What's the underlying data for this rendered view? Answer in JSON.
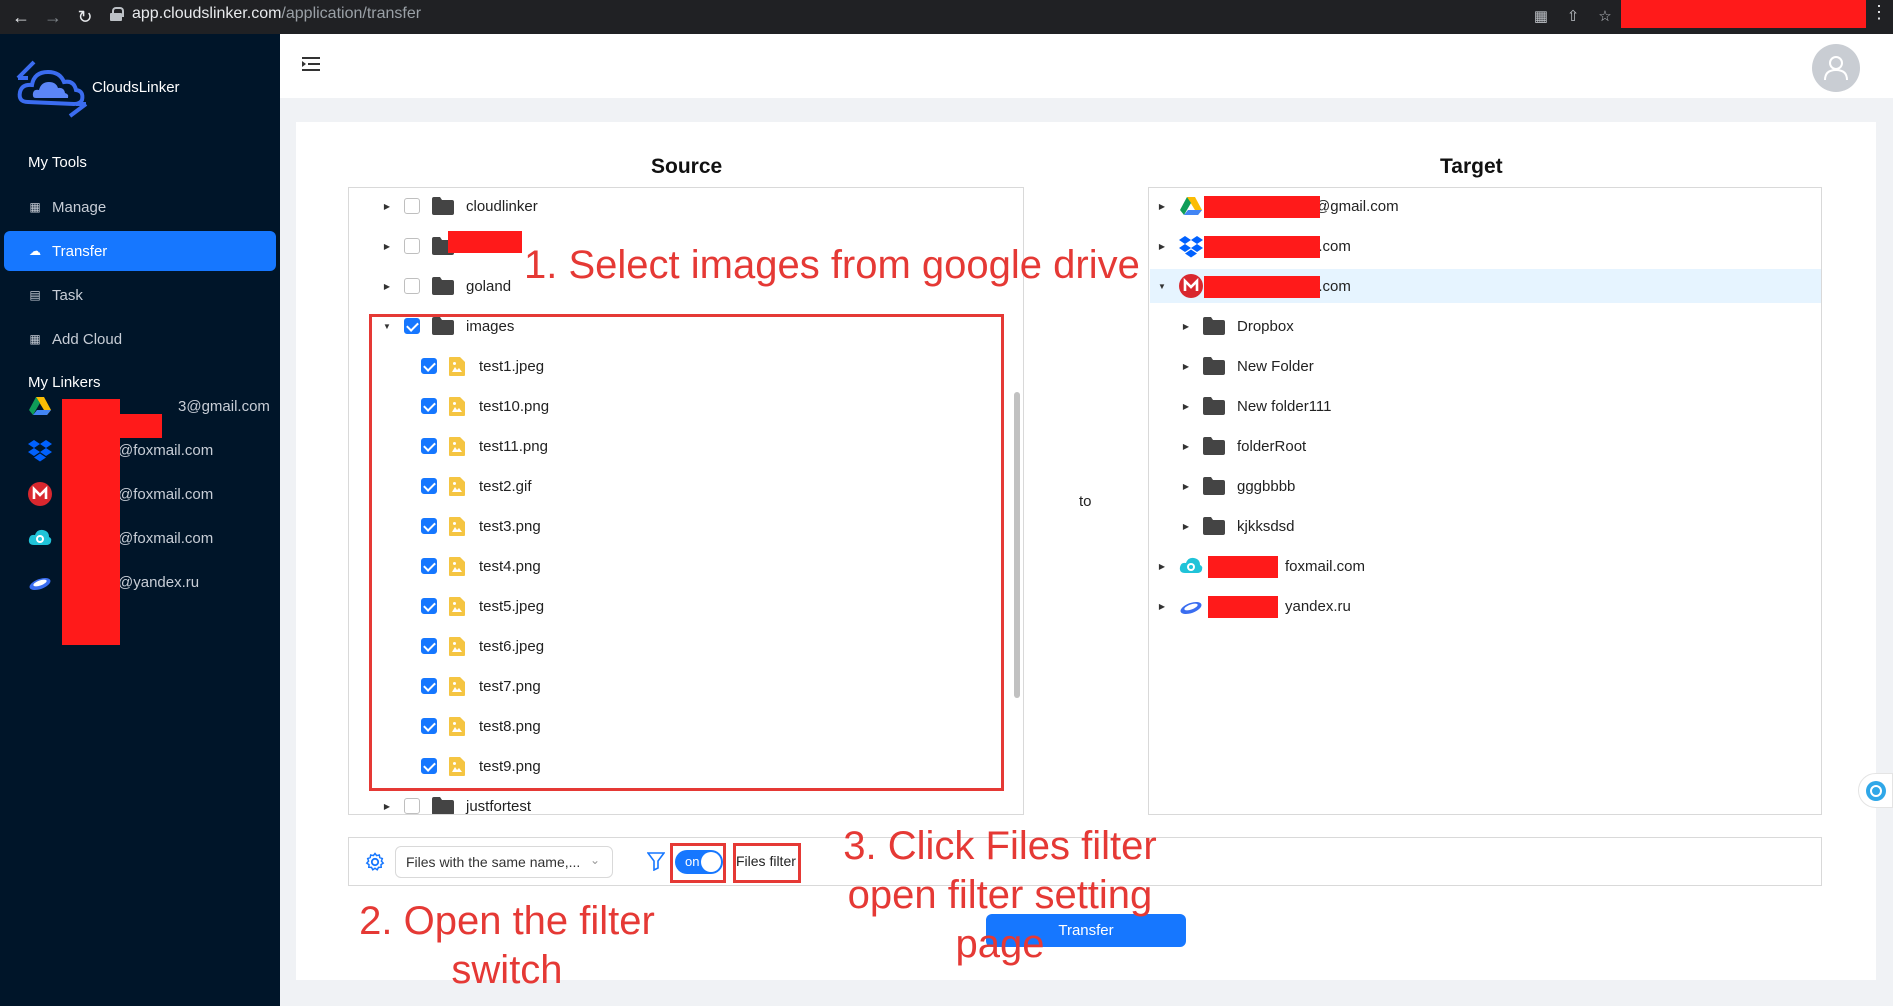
{
  "browser": {
    "url_host": "app.cloudslinker.com",
    "url_path": "/application/transfer"
  },
  "sidebar": {
    "brand": "CloudsLinker",
    "tools_title": "My Tools",
    "menu": [
      {
        "label": "Manage",
        "icon": "grid-icon"
      },
      {
        "label": "Transfer",
        "icon": "cloud-upload-icon"
      },
      {
        "label": "Task",
        "icon": "calendar-icon"
      },
      {
        "label": "Add Cloud",
        "icon": "grid-plus-icon"
      }
    ],
    "linkers_title": "My Linkers",
    "linkers": [
      {
        "label": "3@gmail.com",
        "icon": "google-drive-icon"
      },
      {
        "label": "@foxmail.com",
        "icon": "dropbox-icon"
      },
      {
        "label": "@foxmail.com",
        "icon": "mega-icon"
      },
      {
        "label": "@foxmail.com",
        "icon": "pcloud-icon"
      },
      {
        "label": "@yandex.ru",
        "icon": "yandex-disk-icon"
      }
    ]
  },
  "main": {
    "source_title": "Source",
    "target_title": "Target",
    "to_label": "to",
    "source_tree": [
      {
        "label": "cloudlinker",
        "type": "folder",
        "checked": false
      },
      {
        "label": "",
        "type": "folder",
        "checked": false
      },
      {
        "label": "goland",
        "type": "folder",
        "checked": false
      },
      {
        "label": "images",
        "type": "folder",
        "checked": true,
        "expanded": true
      },
      {
        "label": "test1.jpeg",
        "type": "image",
        "checked": true
      },
      {
        "label": "test10.png",
        "type": "image",
        "checked": true
      },
      {
        "label": "test11.png",
        "type": "image",
        "checked": true
      },
      {
        "label": "test2.gif",
        "type": "image",
        "checked": true
      },
      {
        "label": "test3.png",
        "type": "image",
        "checked": true
      },
      {
        "label": "test4.png",
        "type": "image",
        "checked": true
      },
      {
        "label": "test5.jpeg",
        "type": "image",
        "checked": true
      },
      {
        "label": "test6.jpeg",
        "type": "image",
        "checked": true
      },
      {
        "label": "test7.png",
        "type": "image",
        "checked": true
      },
      {
        "label": "test8.png",
        "type": "image",
        "checked": true
      },
      {
        "label": "test9.png",
        "type": "image",
        "checked": true
      },
      {
        "label": "justfortest",
        "type": "folder",
        "checked": false
      }
    ],
    "target_tree": [
      {
        "label": "@gmail.com",
        "icon": "google-drive-icon"
      },
      {
        "label": "l.com",
        "icon": "dropbox-icon"
      },
      {
        "label": "l.com",
        "icon": "mega-icon",
        "expanded": true
      },
      {
        "label": "Dropbox",
        "icon": "folder-icon"
      },
      {
        "label": "New Folder",
        "icon": "folder-icon"
      },
      {
        "label": "New folder111",
        "icon": "folder-icon"
      },
      {
        "label": "folderRoot",
        "icon": "folder-icon"
      },
      {
        "label": "gggbbbb",
        "icon": "folder-icon"
      },
      {
        "label": "kjkksdsd",
        "icon": "folder-icon"
      },
      {
        "label": "foxmail.com",
        "icon": "pcloud-icon"
      },
      {
        "label": "yandex.ru",
        "icon": "yandex-disk-icon"
      }
    ],
    "bottom": {
      "conflict_select": "Files with the same name,...",
      "toggle_label": "on",
      "files_filter_label": "Files filter"
    },
    "transfer_button": "Transfer"
  },
  "annotations": {
    "step1": "1. Select images from google drive",
    "step2_line1": "2. Open the filter",
    "step2_line2": "switch",
    "step3_line1": "3. Click Files filter",
    "step3_line2": "open filter setting",
    "step3_line3": "page"
  },
  "colors": {
    "sidebar_bg": "#001529",
    "accent": "#1677ff",
    "annotation_red": "#e53935",
    "redaction": "#ff1a1a",
    "folder": "#444444",
    "image_file": "#f5c542"
  }
}
